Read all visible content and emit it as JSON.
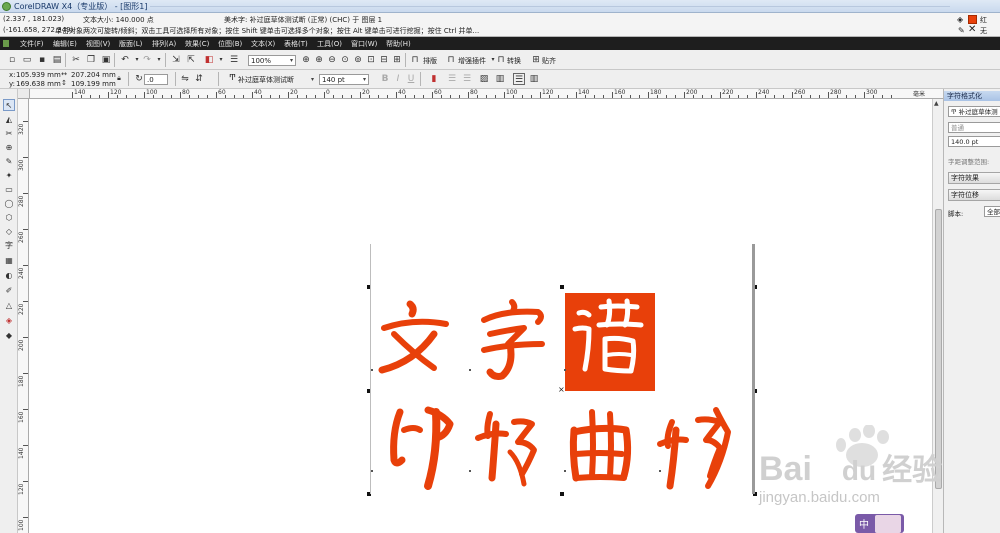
{
  "title_bar": {
    "title": "CorelDRAW X4（专业版） - [图形1]"
  },
  "status": {
    "coords": "(2.337 , 181.023)",
    "text_size": "文本大小: 140.000 点",
    "object_info": "美术字: 补过庭草体测试断 (正常) (CHC) 于 图层 1",
    "coords2": "(-161.658, 272.349)",
    "hint": "单击对象两次可旋转/倾斜；双击工具可选择所有对象；按住 Shift 键单击可选择多个对象；按住 Alt 键单击可进行挖掘；按住 Ctrl 并单...",
    "fill_label": "红",
    "outline_label": "无",
    "fill_color": "#e8400a"
  },
  "menu": [
    "文件(F)",
    "编辑(E)",
    "视图(V)",
    "版面(L)",
    "排列(A)",
    "效果(C)",
    "位图(B)",
    "文本(X)",
    "表格(T)",
    "工具(O)",
    "窗口(W)",
    "帮助(H)"
  ],
  "toolbar1": {
    "zoom": "100%",
    "typeset": "排版",
    "enhance": "增强插件",
    "convert": "转换",
    "snap": "贴齐"
  },
  "toolbar2": {
    "x": "105.939 mm",
    "y": "169.638 mm",
    "w": "207.204 mm",
    "h": "109.199 mm",
    "angle": ".0",
    "font": "补过庭草体测试断",
    "size": "140 pt"
  },
  "hruler": [
    "140",
    "120",
    "100",
    "80",
    "60",
    "40",
    "20",
    "0",
    "20",
    "40",
    "60",
    "80",
    "100",
    "120",
    "140",
    "160",
    "180",
    "200",
    "220",
    "240",
    "260",
    "280",
    "300"
  ],
  "hruler_unit": "毫米",
  "vruler": [
    "320",
    "300",
    "280",
    "260",
    "240",
    "220",
    "200",
    "180",
    "160",
    "140",
    "120",
    "100"
  ],
  "panel": {
    "title": "字符格式化",
    "font": "补过庭草体测",
    "style": "普通",
    "size": "140.0 pt",
    "range_label": "字距调整范围:",
    "effects": "字符效果",
    "shift": "字符位移",
    "script_label": "脚本:",
    "script_value": "全部"
  },
  "artwork": {
    "line1": "文字",
    "line2": "印转曲转",
    "seal": "谱",
    "color": "#e8400a"
  },
  "watermark": {
    "brand": "Bai",
    "brand2": "du",
    "product": "经验",
    "url": "jingyan.baidu.com"
  },
  "ime": {
    "label": "中"
  }
}
